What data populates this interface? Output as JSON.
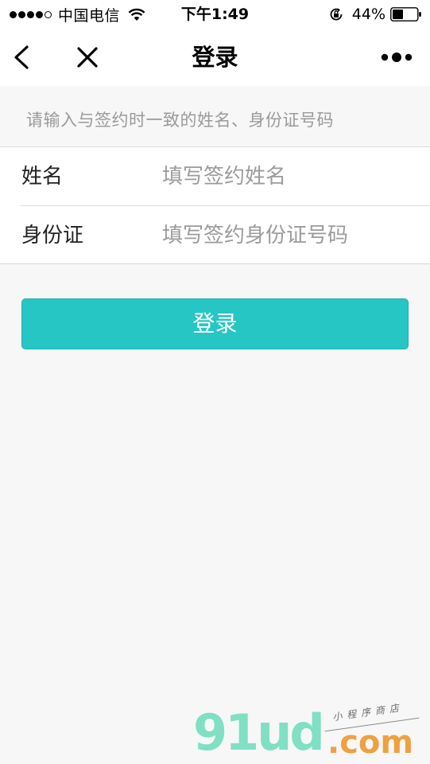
{
  "status_bar": {
    "carrier": "中国电信",
    "time": "下午1:49",
    "battery_percent": "44%",
    "battery_level": 0.44,
    "signal_bars_filled": 4,
    "signal_bars_total": 5,
    "icons": [
      "signal-dots",
      "wifi-icon",
      "rotation-lock-icon",
      "battery-icon"
    ]
  },
  "nav": {
    "title": "登录",
    "back_icon": "chevron-left-icon",
    "close_icon": "close-icon",
    "more_icon": "more-dots-icon"
  },
  "hint": "请输入与签约时一致的姓名、身份证号码",
  "form": {
    "name": {
      "label": "姓名",
      "placeholder": "填写签约姓名",
      "value": ""
    },
    "id_card": {
      "label": "身份证",
      "placeholder": "填写签约身份证号码",
      "value": ""
    }
  },
  "login_button": "登录",
  "watermark": {
    "main": "91ud",
    "dot": ".",
    "com": "com",
    "tag": "小程序商店"
  },
  "colors": {
    "accent": "#26c6c4",
    "background": "#f7f7f7",
    "placeholder": "#9b9b9b",
    "watermark_green": "#7fe0c4",
    "watermark_orange": "#f0a040"
  }
}
